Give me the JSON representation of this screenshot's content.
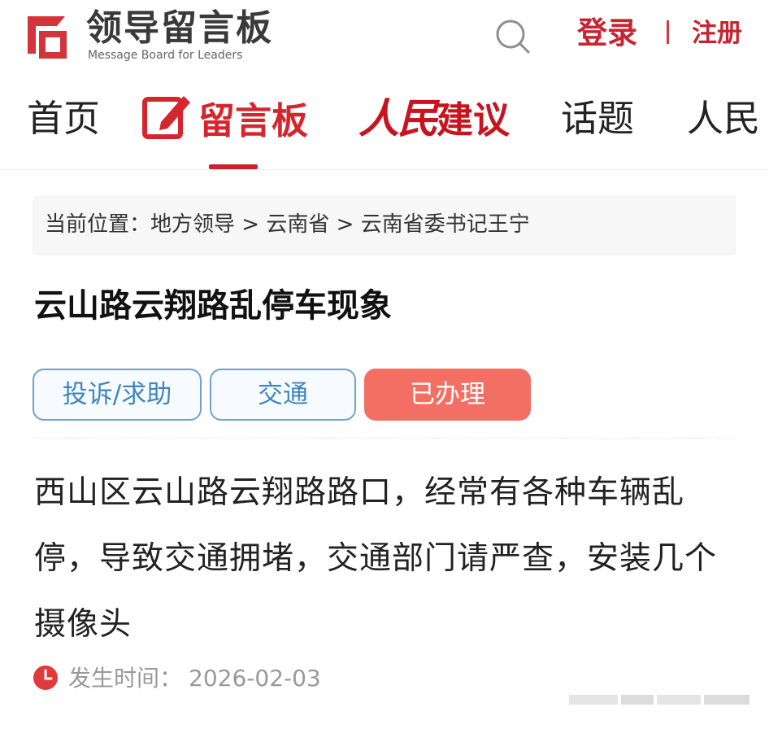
{
  "header": {
    "logo_title": "领导留言板",
    "logo_subtitle": "Message Board for Leaders",
    "login_label": "登录",
    "register_label": "注册"
  },
  "nav": {
    "items": [
      {
        "label": "首页"
      },
      {
        "label": "留言板"
      },
      {
        "label_script": "人民",
        "label_rest": "建议"
      },
      {
        "label": "话题"
      },
      {
        "label": "人民"
      }
    ]
  },
  "breadcrumb": {
    "prefix": "当前位置：",
    "items": [
      "地方领导",
      "云南省",
      "云南省委书记王宁"
    ],
    "separator": " > "
  },
  "post": {
    "title": "云山路云翔路乱停车现象",
    "tags": [
      "投诉/求助",
      "交通",
      "已办理"
    ],
    "content": "西山区云山路云翔路路口，经常有各种车辆乱停，导致交通拥堵，交通部门请严查，安装几个摄像头",
    "time_label": "发生时间：",
    "time_value": "2026-02-03"
  },
  "colors": {
    "brand_red": "#c8242f",
    "tag_blue": "#3f86c2",
    "status_coral": "#f36f64"
  },
  "icons": [
    "logo-icon",
    "search-icon",
    "pen-icon",
    "clock-icon"
  ]
}
